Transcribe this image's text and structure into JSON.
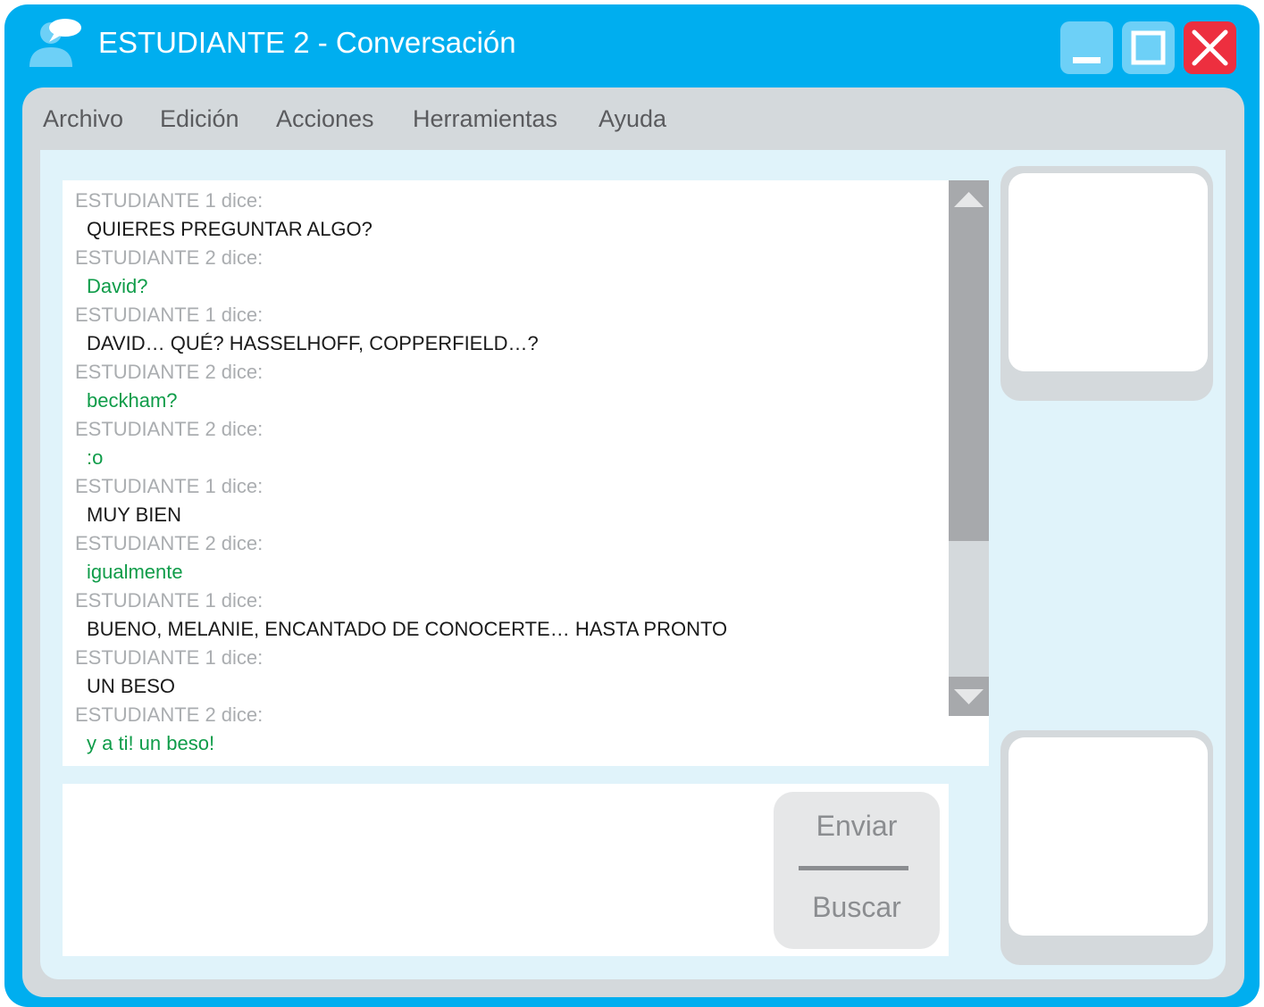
{
  "window": {
    "title": "ESTUDIANTE 2 - Conversación",
    "title_bar_color": "#00aeef",
    "app_icon": "user-chat-icon",
    "controls": [
      {
        "name": "minimize-icon",
        "color": "#6dd0f7"
      },
      {
        "name": "maximize-icon",
        "color": "#6dd0f7"
      },
      {
        "name": "close-icon",
        "color": "#ed2f3f"
      }
    ]
  },
  "menu": {
    "items": [
      "Archivo",
      "Edición",
      "Acciones",
      "Herramientas",
      "Ayuda"
    ]
  },
  "conversation": {
    "messages": [
      {
        "header": "ESTUDIANTE 1 dice:",
        "text": "QUIERES PREGUNTAR ALGO?",
        "sender": 1
      },
      {
        "header": "ESTUDIANTE 2 dice:",
        "text": "David?",
        "sender": 2
      },
      {
        "header": "ESTUDIANTE 1 dice:",
        "text": "DAVID… QUÉ? HASSELHOFF, COPPERFIELD…?",
        "sender": 1
      },
      {
        "header": "ESTUDIANTE 2 dice:",
        "text": "beckham?",
        "sender": 2
      },
      {
        "header": "ESTUDIANTE 2 dice:",
        "text": ":o",
        "sender": 2
      },
      {
        "header": "ESTUDIANTE 1 dice:",
        "text": "MUY BIEN",
        "sender": 1
      },
      {
        "header": "ESTUDIANTE 2 dice:",
        "text": "igualmente",
        "sender": 2
      },
      {
        "header": "ESTUDIANTE 1 dice:",
        "text": "BUENO, MELANIE, ENCANTADO DE CONOCERTE… HASTA PRONTO",
        "sender": 1
      },
      {
        "header": "ESTUDIANTE 1 dice:",
        "text": "UN BESO",
        "sender": 1
      },
      {
        "header": "ESTUDIANTE 2 dice:",
        "text": "y a ti! un beso!",
        "sender": 2
      }
    ],
    "sender_colors": {
      "1": "#1a1a1a",
      "2": "#0f9c49"
    },
    "scroll_position": 0
  },
  "compose": {
    "value": "",
    "send_label": "Enviar",
    "search_label": "Buscar"
  }
}
